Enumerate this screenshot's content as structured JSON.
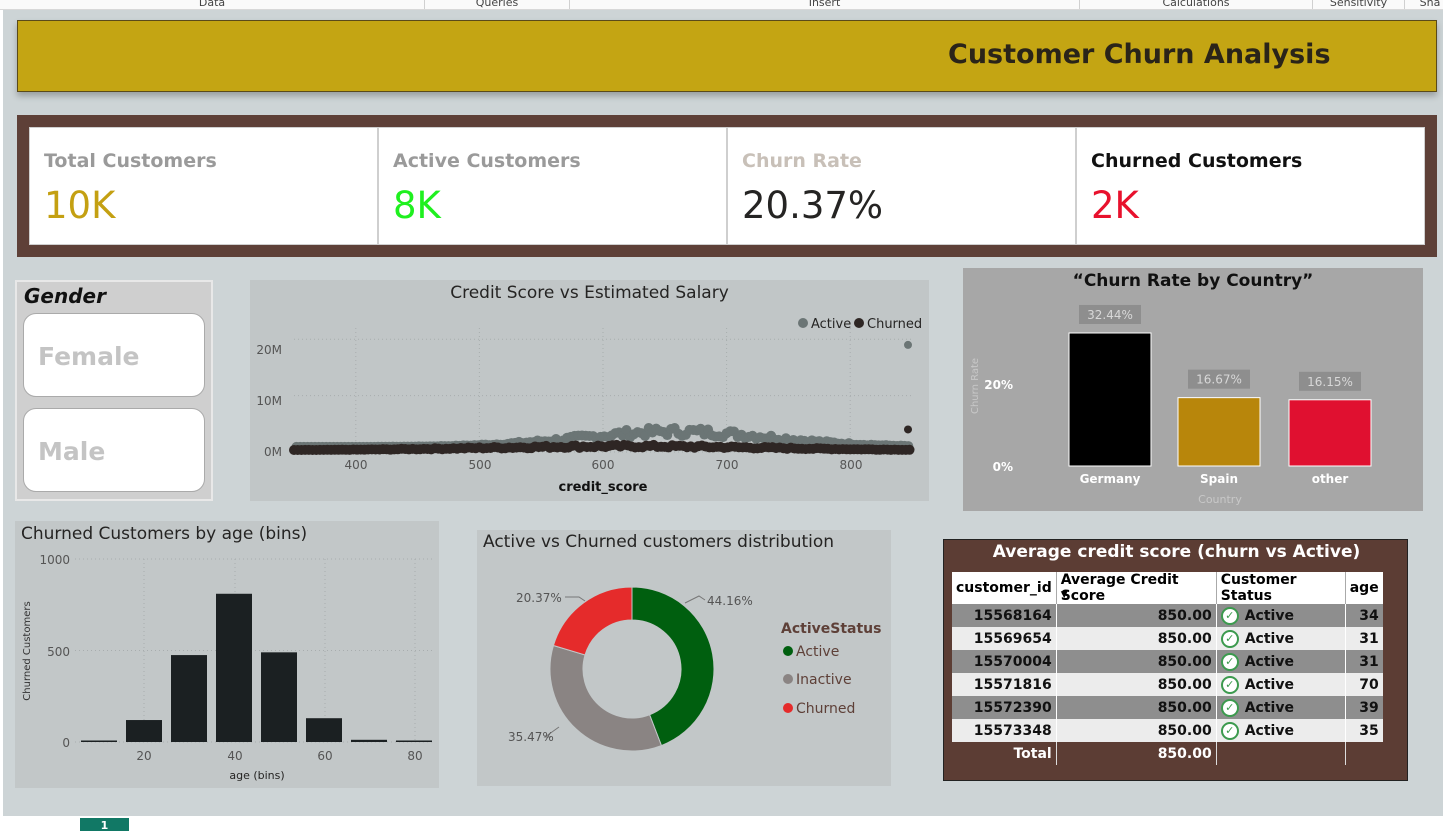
{
  "ribbon": {
    "tabs": [
      "Data",
      "Queries",
      "Insert",
      "Calculations",
      "Sensitivity",
      "Sha"
    ]
  },
  "title": "Customer Churn Analysis",
  "kpis": [
    {
      "label": "Total Customers",
      "value": "10K",
      "label_color": "#9a9a9a",
      "value_color": "#c4a012"
    },
    {
      "label": "Active Customers",
      "value": "8K",
      "label_color": "#9a9a9a",
      "value_color": "#1ff01f"
    },
    {
      "label": "Churn Rate",
      "value": "20.37%",
      "label_color": "#c8c0b8",
      "value_color": "#252423"
    },
    {
      "label": "Churned Customers",
      "value": "2K",
      "label_color": "#111111",
      "value_color": "#e8112d"
    }
  ],
  "gender_slicer": {
    "title": "Gender",
    "options": [
      "Female",
      "Male"
    ]
  },
  "scatter": {
    "title": "Credit Score vs Estimated Salary",
    "legend": [
      {
        "name": "Active",
        "color": "#6b7575"
      },
      {
        "name": "Churned",
        "color": "#2e2624"
      }
    ],
    "y_ticks": [
      "20M",
      "10M",
      "0M"
    ],
    "x_ticks": [
      "400",
      "500",
      "600",
      "700",
      "800"
    ],
    "x_label": "credit_score"
  },
  "country_chart": {
    "title": "“Churn Rate by Country”",
    "y_label": "Churn Rate",
    "x_label": "Country",
    "y_ticks": [
      "20%",
      "0%"
    ],
    "bars": [
      {
        "category": "Germany",
        "label": "32.44%",
        "value": 32.44,
        "color": "#000000"
      },
      {
        "category": "Spain",
        "label": "16.67%",
        "value": 16.67,
        "color": "#b8860b"
      },
      {
        "category": "other",
        "label": "16.15%",
        "value": 16.15,
        "color": "#e01030"
      }
    ]
  },
  "age_chart": {
    "title": "Churned Customers by age (bins)",
    "y_label": "Churned Customers",
    "x_label": "age (bins)",
    "y_ticks": [
      "1000",
      "500",
      "0"
    ],
    "x_ticks": [
      "20",
      "40",
      "60",
      "80"
    ]
  },
  "donut": {
    "title": "Active vs Churned customers distribution",
    "legend_title": "ActiveStatus",
    "legend": [
      {
        "name": "Active",
        "color": "#005f0f"
      },
      {
        "name": "Inactive",
        "color": "#8a8483"
      },
      {
        "name": "Churned",
        "color": "#e52b2b"
      }
    ],
    "labels": [
      "44.16%",
      "35.47%",
      "20.37%"
    ]
  },
  "avg_table": {
    "title": "Average credit score (churn vs Active)",
    "columns": [
      "customer_id",
      "Average Credit Score",
      "Customer Status",
      "age"
    ],
    "rows": [
      [
        "15568164",
        "850.00",
        "Active",
        "34"
      ],
      [
        "15569654",
        "850.00",
        "Active",
        "31"
      ],
      [
        "15570004",
        "850.00",
        "Active",
        "31"
      ],
      [
        "15571816",
        "850.00",
        "Active",
        "70"
      ],
      [
        "15572390",
        "850.00",
        "Active",
        "39"
      ],
      [
        "15573348",
        "850.00",
        "Active",
        "35"
      ]
    ],
    "total_label": "Total",
    "total_value": "850.00"
  },
  "page_tab": {
    "label": "1"
  },
  "chart_data": [
    {
      "type": "scatter",
      "title": "Credit Score vs Estimated Salary",
      "xlabel": "credit_score",
      "ylabel": "",
      "xlim": [
        350,
        850
      ],
      "ylim": [
        0,
        22000000
      ],
      "series": [
        {
          "name": "Active",
          "points": [
            [
              850,
              19000000
            ],
            [
              650,
              3500000
            ],
            [
              700,
              3800000
            ],
            [
              600,
              3000000
            ]
          ]
        },
        {
          "name": "Churned",
          "points": [
            [
              850,
              4000000
            ],
            [
              400,
              500000
            ],
            [
              500,
              700000
            ],
            [
              600,
              900000
            ],
            [
              700,
              1000000
            ],
            [
              800,
              800000
            ]
          ]
        }
      ],
      "legend": "top-right",
      "grid": true
    },
    {
      "type": "bar",
      "title": "“Churn Rate by Country”",
      "categories": [
        "Germany",
        "Spain",
        "other"
      ],
      "values": [
        32.44,
        16.67,
        16.15
      ],
      "xlabel": "Country",
      "ylabel": "Churn Rate",
      "unit": "%"
    },
    {
      "type": "bar",
      "title": "Churned Customers by age (bins)",
      "categories": [
        10,
        20,
        30,
        40,
        50,
        60,
        70,
        80
      ],
      "values": [
        5,
        120,
        475,
        810,
        490,
        130,
        12,
        5
      ],
      "xlabel": "age (bins)",
      "ylabel": "Churned Customers",
      "ylim": [
        0,
        1000
      ],
      "grid": true
    },
    {
      "type": "pie",
      "title": "Active vs Churned customers distribution",
      "categories": [
        "Active",
        "Inactive",
        "Churned"
      ],
      "values": [
        44.16,
        35.47,
        20.37
      ],
      "legend": "right"
    }
  ]
}
